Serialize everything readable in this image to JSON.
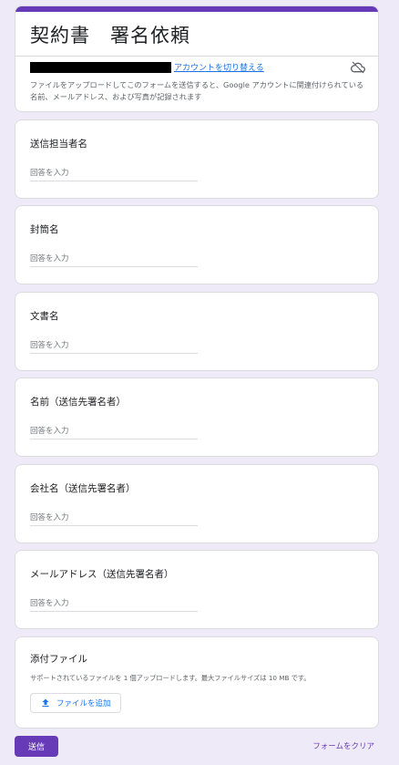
{
  "form": {
    "title": "契約書　署名依頼",
    "switch_account_label": "アカウントを切り替える",
    "notice": "ファイルをアップロードしてこのフォームを送信すると、Google アカウントに関連付けられている名前、メールアドレス、および写真が記録されます",
    "cloud_icon": "cloud-off-icon"
  },
  "questions": [
    {
      "label": "送信担当者名",
      "placeholder": "回答を入力"
    },
    {
      "label": "封筒名",
      "placeholder": "回答を入力"
    },
    {
      "label": "文書名",
      "placeholder": "回答を入力"
    },
    {
      "label": "名前（送信先署名者）",
      "placeholder": "回答を入力"
    },
    {
      "label": "会社名（送信先署名者）",
      "placeholder": "回答を入力"
    },
    {
      "label": "メールアドレス（送信先署名者）",
      "placeholder": "回答を入力"
    }
  ],
  "attachment": {
    "label": "添付ファイル",
    "description": "サポートされているファイルを 1 個アップロードします。最大ファイルサイズは 10 MB です。",
    "add_button_label": "ファイルを追加",
    "icon": "upload-icon"
  },
  "footer": {
    "submit_label": "送信",
    "clear_label": "フォームをクリア"
  },
  "colors": {
    "accent": "#673ab7",
    "link": "#1a73e8",
    "background": "#efeaf7"
  }
}
